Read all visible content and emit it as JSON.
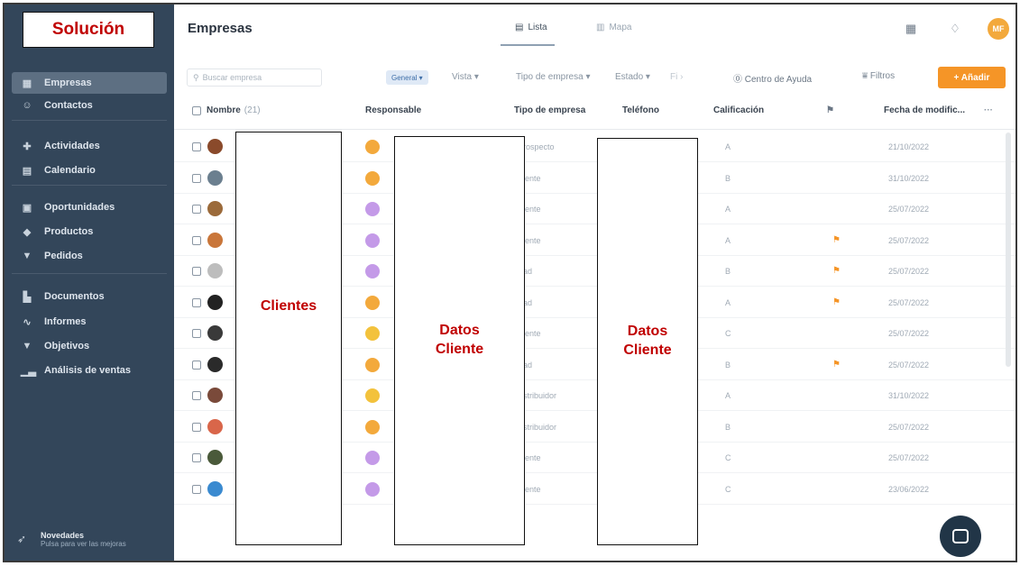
{
  "sidebar": {
    "logo_text": "Solución",
    "items": [
      {
        "label": "Empresas",
        "icon": "building-icon",
        "glyph": "▦",
        "active": true
      },
      {
        "label": "Contactos",
        "icon": "contact-icon",
        "glyph": "☺"
      },
      {
        "label": "Actividades",
        "icon": "activities-icon",
        "glyph": "✚"
      },
      {
        "label": "Calendario",
        "icon": "calendar-icon",
        "glyph": "▤"
      },
      {
        "label": "Oportunidades",
        "icon": "briefcase-icon",
        "glyph": "▣"
      },
      {
        "label": "Productos",
        "icon": "tag-icon",
        "glyph": "◆"
      },
      {
        "label": "Pedidos",
        "icon": "cart-icon",
        "glyph": "▼"
      },
      {
        "label": "Documentos",
        "icon": "document-icon",
        "glyph": "▙"
      },
      {
        "label": "Informes",
        "icon": "chart-line-icon",
        "glyph": "∿"
      },
      {
        "label": "Objetivos",
        "icon": "trophy-icon",
        "glyph": "▼"
      },
      {
        "label": "Análisis de ventas",
        "icon": "bar-chart-icon",
        "glyph": "▁▃"
      }
    ],
    "novedades_title": "Novedades",
    "novedades_subtitle": "Pulsa para ver las mejoras"
  },
  "header": {
    "title": "Empresas",
    "tab_lista": "Lista",
    "tab_mapa": "Mapa",
    "avatar": "MF"
  },
  "toolbar": {
    "search_placeholder": "Buscar empresa",
    "general": "General ▾",
    "vista": "Vista ▾",
    "tipo_empresa": "Tipo de empresa ▾",
    "estado": "Estado ▾",
    "more": "Fi ›",
    "ayuda": "⓪ Centro de Ayuda",
    "filtros": "⩸ Filtros",
    "anadir": "+ Añadir"
  },
  "table": {
    "headers": {
      "nombre": "Nombre",
      "nombre_count": "(21)",
      "responsable": "Responsable",
      "tipo": "Tipo de empresa",
      "telefono": "Teléfono",
      "calificacion": "Calificación",
      "fecha": "Fecha de modific...",
      "more": "···"
    },
    "rows": [
      {
        "tipo": "rospecto",
        "calif": "A",
        "flag": false,
        "fecha": "21/10/2022",
        "logo_color": "#8a4a2b",
        "resp_color": "#f3a93c"
      },
      {
        "tipo": "iente",
        "calif": "B",
        "flag": false,
        "fecha": "31/10/2022",
        "logo_color": "#6b7f8f",
        "resp_color": "#f3a93c"
      },
      {
        "tipo": "iente",
        "calif": "A",
        "flag": false,
        "fecha": "25/07/2022",
        "logo_color": "#9b6a3a",
        "resp_color": "#c49ae8"
      },
      {
        "tipo": "iente",
        "calif": "A",
        "flag": true,
        "fecha": "25/07/2022",
        "logo_color": "#c9763a",
        "resp_color": "#c49ae8"
      },
      {
        "tipo": "ad",
        "calif": "B",
        "flag": true,
        "fecha": "25/07/2022",
        "logo_color": "#bdbdbd",
        "resp_color": "#c49ae8"
      },
      {
        "tipo": "ad",
        "calif": "A",
        "flag": true,
        "fecha": "25/07/2022",
        "logo_color": "#222222",
        "resp_color": "#f3a93c"
      },
      {
        "tipo": "iente",
        "calif": "C",
        "flag": false,
        "fecha": "25/07/2022",
        "logo_color": "#3a3a3a",
        "resp_color": "#f3c23c"
      },
      {
        "tipo": "ad",
        "calif": "B",
        "flag": true,
        "fecha": "25/07/2022",
        "logo_color": "#2a2a2a",
        "resp_color": "#f3a93c"
      },
      {
        "tipo": "stribuidor",
        "calif": "A",
        "flag": false,
        "fecha": "31/10/2022",
        "logo_color": "#7a4a3a",
        "resp_color": "#f3c23c"
      },
      {
        "tipo": "stribuidor",
        "calif": "B",
        "flag": false,
        "fecha": "25/07/2022",
        "logo_color": "#d9664a",
        "resp_color": "#f3a93c"
      },
      {
        "tipo": "iente",
        "calif": "C",
        "flag": false,
        "fecha": "25/07/2022",
        "logo_color": "#4a5a3a",
        "resp_color": "#c49ae8"
      },
      {
        "tipo": "iente",
        "calif": "C",
        "flag": false,
        "fecha": "23/06/2022",
        "logo_color": "#3a8ad0",
        "resp_color": "#c49ae8"
      }
    ]
  },
  "annotations": {
    "clientes": "Clientes",
    "datos_1": "Datos\nCliente",
    "datos_2": "Datos\nCliente"
  },
  "colors": {
    "sidebar_bg": "#33465a",
    "accent_orange": "#f59527",
    "annotation_red": "#c00000"
  }
}
